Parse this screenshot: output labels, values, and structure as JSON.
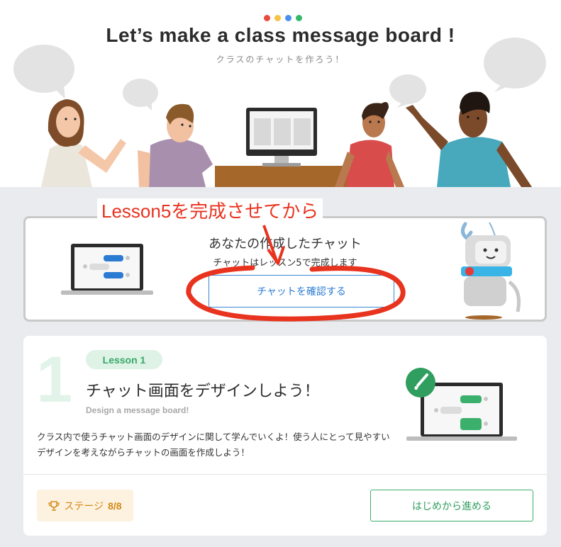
{
  "hero": {
    "title": "Let’s make a class message board !",
    "subtitle": "クラスのチャットを作ろう！",
    "dot_colors": [
      "#e94b3c",
      "#f6c344",
      "#4b8ef0",
      "#35b869"
    ]
  },
  "chat_card": {
    "title": "あなたの作成したチャット",
    "subtitle": "チャットはレッスン5で完成します",
    "button_label": "チャットを確認する"
  },
  "annotation": {
    "label": "Lesson5を完成させてから",
    "color": "#e8331f"
  },
  "lesson": {
    "number": "1",
    "badge": "Lesson 1",
    "title": "チャット画面をデザインしよう！",
    "title_en": "Design a message board!",
    "description": "クラス内で使うチャット画面のデザインに関して学んでいくよ！使う人にとって見やすいデザインを考えながらチャットの画面を作成しよう！",
    "stage_label": "ステージ",
    "stage_value": "8/8",
    "start_button": "はじめから進める",
    "icons": {
      "trophy": "trophy-icon",
      "brush": "paintbrush-icon"
    }
  },
  "colors": {
    "accent_blue": "#2a7bd2",
    "accent_green": "#3bb06d",
    "stage_orange": "#d38915"
  }
}
